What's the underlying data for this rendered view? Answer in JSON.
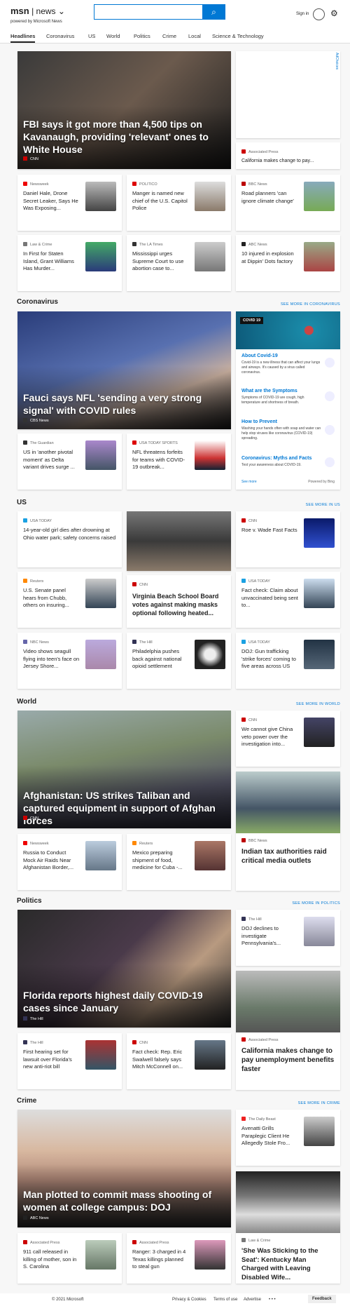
{
  "header": {
    "logo": "msn",
    "news": "news",
    "caret": "⌄",
    "tagline": "powered by Microsoft News",
    "search_placeholder": "",
    "signin": "Sign in"
  },
  "nav": [
    "Headlines",
    "Coronavirus",
    "US",
    "World",
    "Politics",
    "Crime",
    "Local",
    "Science & Technology"
  ],
  "hero": {
    "title": "FBI says it got more than 4,500 tips on Kavanaugh, providing 'relevant' ones to White House",
    "source": "CNN"
  },
  "adchoices": "AdChoices",
  "top_right": {
    "source": "Associated Press",
    "title": "California makes change to pay..."
  },
  "row1": [
    {
      "source": "Newsweek",
      "title": "Daniel Hale, Drone Secret Leaker, Says He Was Exposing..."
    },
    {
      "source": "POLITICO",
      "title": "Manger is named new chief of the U.S. Capitol Police"
    },
    {
      "source": "BBC News",
      "title": "Road planners 'can ignore climate change'"
    }
  ],
  "row2": [
    {
      "source": "Law & Crime",
      "title": "In First for Staten Island, Grant Williams Has Murder..."
    },
    {
      "source": "The LA Times",
      "title": "Mississippi urges Supreme Court to use abortion case to..."
    },
    {
      "source": "ABC News",
      "title": "10 injured in explosion at Dippin' Dots factory"
    }
  ],
  "sections": {
    "coronavirus": "Coronavirus",
    "us": "US",
    "world": "World",
    "politics": "Politics",
    "crime": "Crime"
  },
  "see_more": {
    "coronavirus": "SEE MORE IN CORONAVIRUS",
    "us": "SEE MORE IN US",
    "world": "SEE MORE IN WORLD",
    "politics": "SEE MORE IN POLITICS",
    "crime": "SEE MORE IN CRIME"
  },
  "covid_hero": {
    "title": "Fauci says NFL 'sending a very strong signal' with COVID rules",
    "source": "CBS News"
  },
  "covid_panel": {
    "badge": "COVID 19",
    "items": [
      {
        "title": "About Covid-19",
        "desc": "Covid-19 is a new illness that can affect your lungs and airways. It's caused by a virus called coronavirus."
      },
      {
        "title": "What are the Symptoms",
        "desc": "Symptoms of COVID-19 are cough, high temperature and shortness of breath."
      },
      {
        "title": "How to Prevent",
        "desc": "Washing your hands often with soap and water can help stop viruses like coronavirus (COVID-19) spreading."
      },
      {
        "title": "Coronavirus: Myths and Facts",
        "desc": "Test your awareness about COVID-19."
      }
    ],
    "see_more": "See more",
    "powered": "Powered by Bing"
  },
  "covid_row": [
    {
      "source": "The Guardian",
      "title": "US in 'another pivotal moment' as Delta variant drives surge ..."
    },
    {
      "source": "USA TODAY SPORTS",
      "title": "NFL threatens forfeits for teams with COVID-19 outbreak..."
    }
  ],
  "us": {
    "a": {
      "source": "USA TODAY",
      "title": "14-year-old girl dies after drowning at Ohio water park; safety concerns raised"
    },
    "b": {
      "source": "CNN",
      "title": "Roe v. Wade Fast Facts"
    },
    "c": {
      "source": "Reuters",
      "title": "U.S. Senate panel hears from Chubb, others on insuring..."
    },
    "d": {
      "source": "CNN",
      "title": "Virginia Beach School Board votes against making masks optional following heated..."
    },
    "e": {
      "source": "USA TODAY",
      "title": "Fact check: Claim about unvaccinated being sent to..."
    },
    "f": {
      "source": "NBC News",
      "title": "Video shows seagull flying into teen's face on Jersey Shore..."
    },
    "g": {
      "source": "The Hill",
      "title": "Philadelphia pushes back against national opioid settlement"
    },
    "h": {
      "source": "USA TODAY",
      "title": "DOJ: Gun trafficking 'strike forces' coming to five areas across US"
    }
  },
  "world": {
    "hero": {
      "title": "Afghanistan: US strikes Taliban and captured equipment in support of Afghan forces",
      "source": "CNN"
    },
    "a": {
      "source": "CNN",
      "title": "We cannot give China veto power over the investigation into..."
    },
    "b": {
      "source": "BBC News",
      "title": "Indian tax authorities raid critical media outlets"
    },
    "c": {
      "source": "Newsweek",
      "title": "Russia to Conduct Mock Air Raids Near Afghanistan Border,..."
    },
    "d": {
      "source": "Reuters",
      "title": "Mexico preparing shipment of food, medicine for Cuba -..."
    }
  },
  "politics": {
    "hero": {
      "title": "Florida reports highest daily COVID-19 cases since January",
      "source": "The Hill"
    },
    "a": {
      "source": "The Hill",
      "title": "DOJ declines to investigate Pennsylvania's..."
    },
    "b": {
      "source": "Associated Press",
      "title": "California makes change to pay unemployment benefits faster"
    },
    "c": {
      "source": "The Hill",
      "title": "First hearing set for lawsuit over Florida's new anti-riot bill"
    },
    "d": {
      "source": "CNN",
      "title": "Fact check: Rep. Eric Swalwell falsely says Mitch McConnell on..."
    }
  },
  "crime": {
    "hero": {
      "title": "Man plotted to commit mass shooting of women at college campus: DOJ",
      "source": "ABC News"
    },
    "a": {
      "source": "The Daily Beast",
      "title": "Avenatti Grills Paraplegic Client He Allegedly Stole Fro..."
    },
    "b": {
      "source": "Law & Crime",
      "title": "'She Was Sticking to the Seat': Kentucky Man Charged with Leaving Disabled Wife..."
    },
    "c": {
      "source": "Associated Press",
      "title": "911 call released in killing of mother, son in S. Carolina"
    },
    "d": {
      "source": "Associated Press",
      "title": "Ranger: 3 charged in 4 Texas killings planned to steal gun"
    }
  },
  "footer": {
    "copyright": "© 2021 Microsoft",
    "privacy": "Privacy & Cookies",
    "terms": "Terms of use",
    "advertise": "Advertise",
    "dots": "• • •",
    "feedback": "Feedback"
  }
}
